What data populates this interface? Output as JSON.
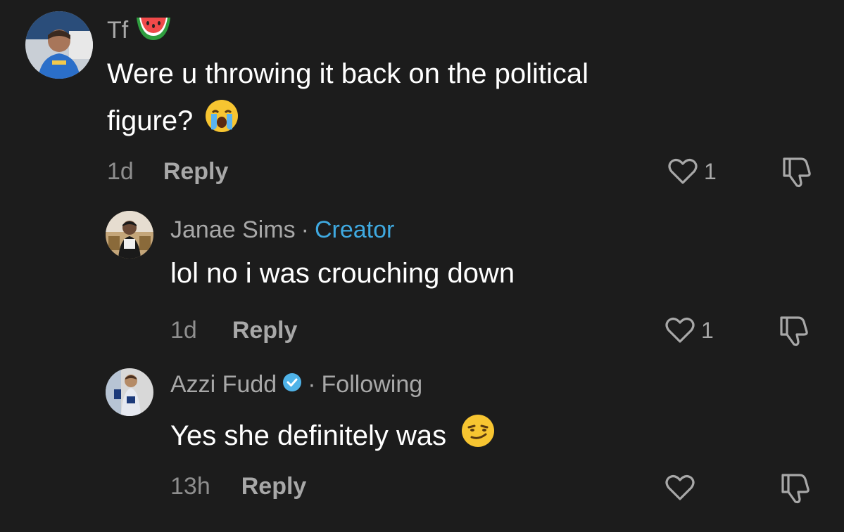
{
  "colors": {
    "background": "#1c1c1c",
    "text_primary": "#ffffff",
    "text_secondary": "#a8a8a8",
    "creator_accent": "#3fa9e0",
    "verified_badge": "#4fb3e8"
  },
  "comments": [
    {
      "username": "Tf",
      "username_emoji": "watermelon-emoji",
      "text_line1": "Were u throwing it back on the political",
      "text_line2": "figure?",
      "text_emoji": "loudly-crying-face-emoji",
      "time": "1d",
      "reply_label": "Reply",
      "like_count": "1",
      "like_icon": "heart-outline-icon",
      "dislike_icon": "thumbs-down-icon"
    },
    {
      "username": "Janae Sims",
      "separator": "·",
      "badge": "Creator",
      "text": "lol no i was crouching down",
      "time": "1d",
      "reply_label": "Reply",
      "like_count": "1",
      "like_icon": "heart-outline-icon",
      "dislike_icon": "thumbs-down-icon"
    },
    {
      "username": "Azzi Fudd",
      "verified_icon": "verified-badge-icon",
      "separator": "·",
      "badge": "Following",
      "text": "Yes she definitely was",
      "text_emoji": "smirking-face-emoji",
      "time": "13h",
      "reply_label": "Reply",
      "like_icon": "heart-outline-icon",
      "dislike_icon": "thumbs-down-icon"
    }
  ]
}
